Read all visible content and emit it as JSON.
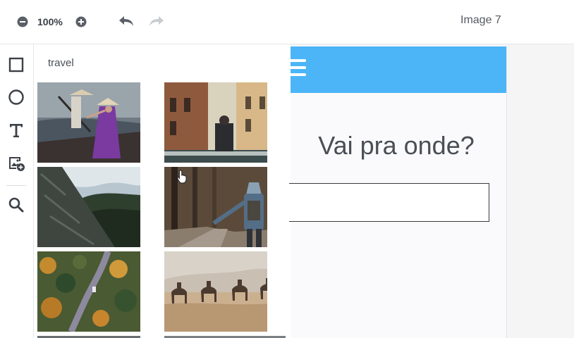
{
  "toolbar": {
    "zoom_level": "100%",
    "zoom_out_icon": "minus-circle-icon",
    "zoom_in_icon": "plus-circle-icon",
    "undo_icon": "undo-arrow-icon",
    "redo_icon": "redo-arrow-icon",
    "document_title": "Image 7"
  },
  "tools": [
    {
      "name": "rectangle-tool",
      "icon": "square-icon"
    },
    {
      "name": "ellipse-tool",
      "icon": "circle-icon"
    },
    {
      "name": "text-tool",
      "icon": "text-t-icon"
    },
    {
      "name": "image-tool",
      "icon": "image-add-icon"
    },
    {
      "name": "search-tool",
      "icon": "search-icon"
    }
  ],
  "image_panel": {
    "query": "travel",
    "results": [
      {
        "subject": "women in conical hats on a boat"
      },
      {
        "subject": "venice canal with gondolier"
      },
      {
        "subject": "forest cliff from below"
      },
      {
        "subject": "hooded hiker in autumn forest"
      },
      {
        "subject": "aerial road through autumn forest"
      },
      {
        "subject": "camel caravan in desert"
      }
    ]
  },
  "artboard": {
    "header_color": "#4bb5f8",
    "menu_icon": "hamburger-menu-icon",
    "heading": "Vai pra onde?",
    "input_value": ""
  },
  "colors": {
    "accent": "#4bb5f8",
    "icon": "#3b4047",
    "icon_disabled": "#c4c7cc"
  }
}
